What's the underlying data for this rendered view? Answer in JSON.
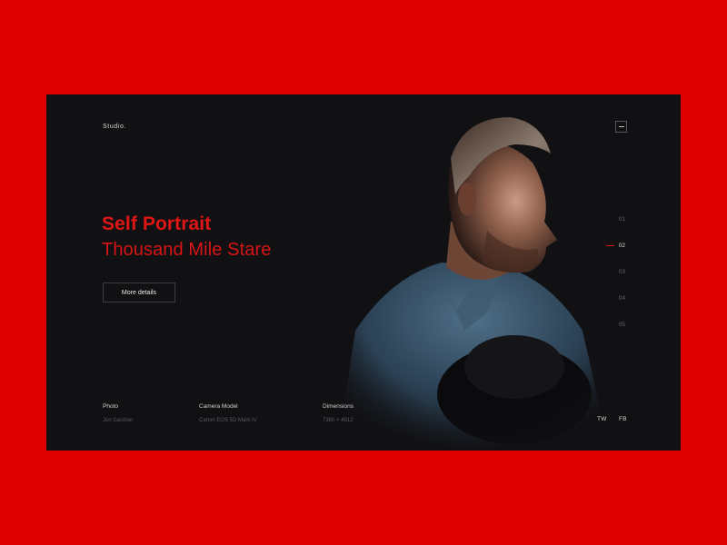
{
  "colors": {
    "background": "#e00000",
    "panel": "#111114",
    "accent": "#e01515"
  },
  "header": {
    "brand": "Studio.",
    "menu_icon": "hamburger-icon"
  },
  "hero": {
    "title": "Self Portrait",
    "subtitle": "Thousand Mile Stare",
    "button_label": "More details"
  },
  "pager": {
    "items": [
      "01",
      "02",
      "03",
      "04",
      "05"
    ],
    "active_index": 1
  },
  "meta": {
    "photo_label": "Photo",
    "photo_value": "Jon Gardner",
    "camera_label": "Camera Model",
    "camera_value": "Canon EOS 5D Mark IV",
    "dimensions_label": "Dimensions",
    "dimensions_value": "7360 × 4912"
  },
  "social": {
    "tw": "TW",
    "fb": "FB"
  }
}
